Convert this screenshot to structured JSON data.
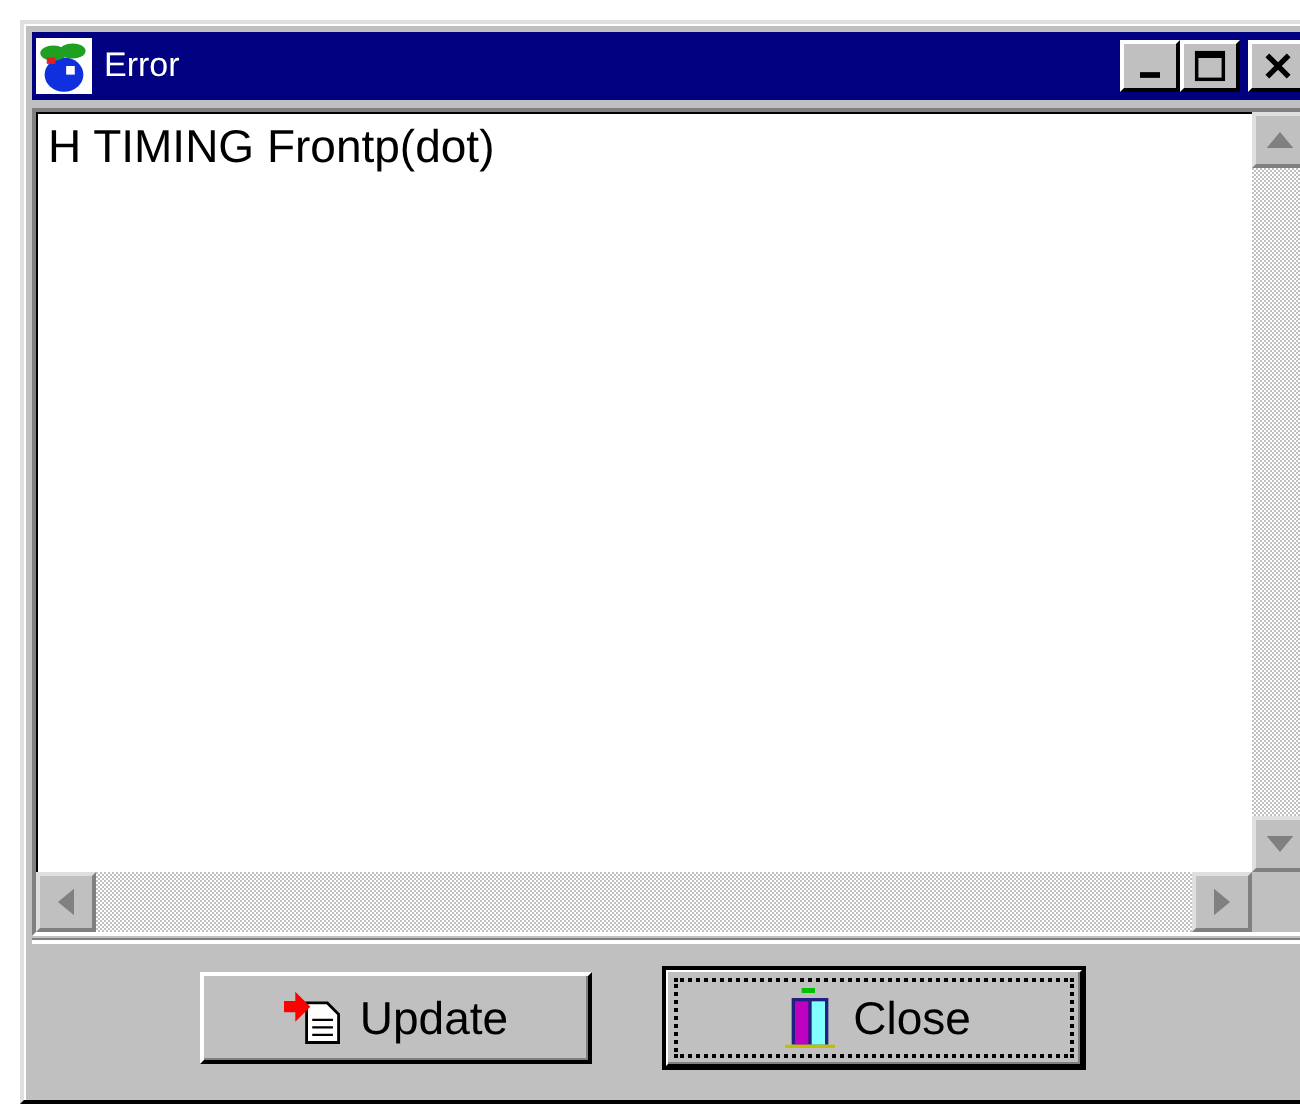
{
  "window": {
    "title": "Error"
  },
  "message": {
    "text": "H TIMING Frontp(dot)"
  },
  "buttons": [
    {
      "label": "Update",
      "kind": "update",
      "focused": false
    },
    {
      "label": "Close",
      "kind": "close",
      "focused": true
    }
  ]
}
